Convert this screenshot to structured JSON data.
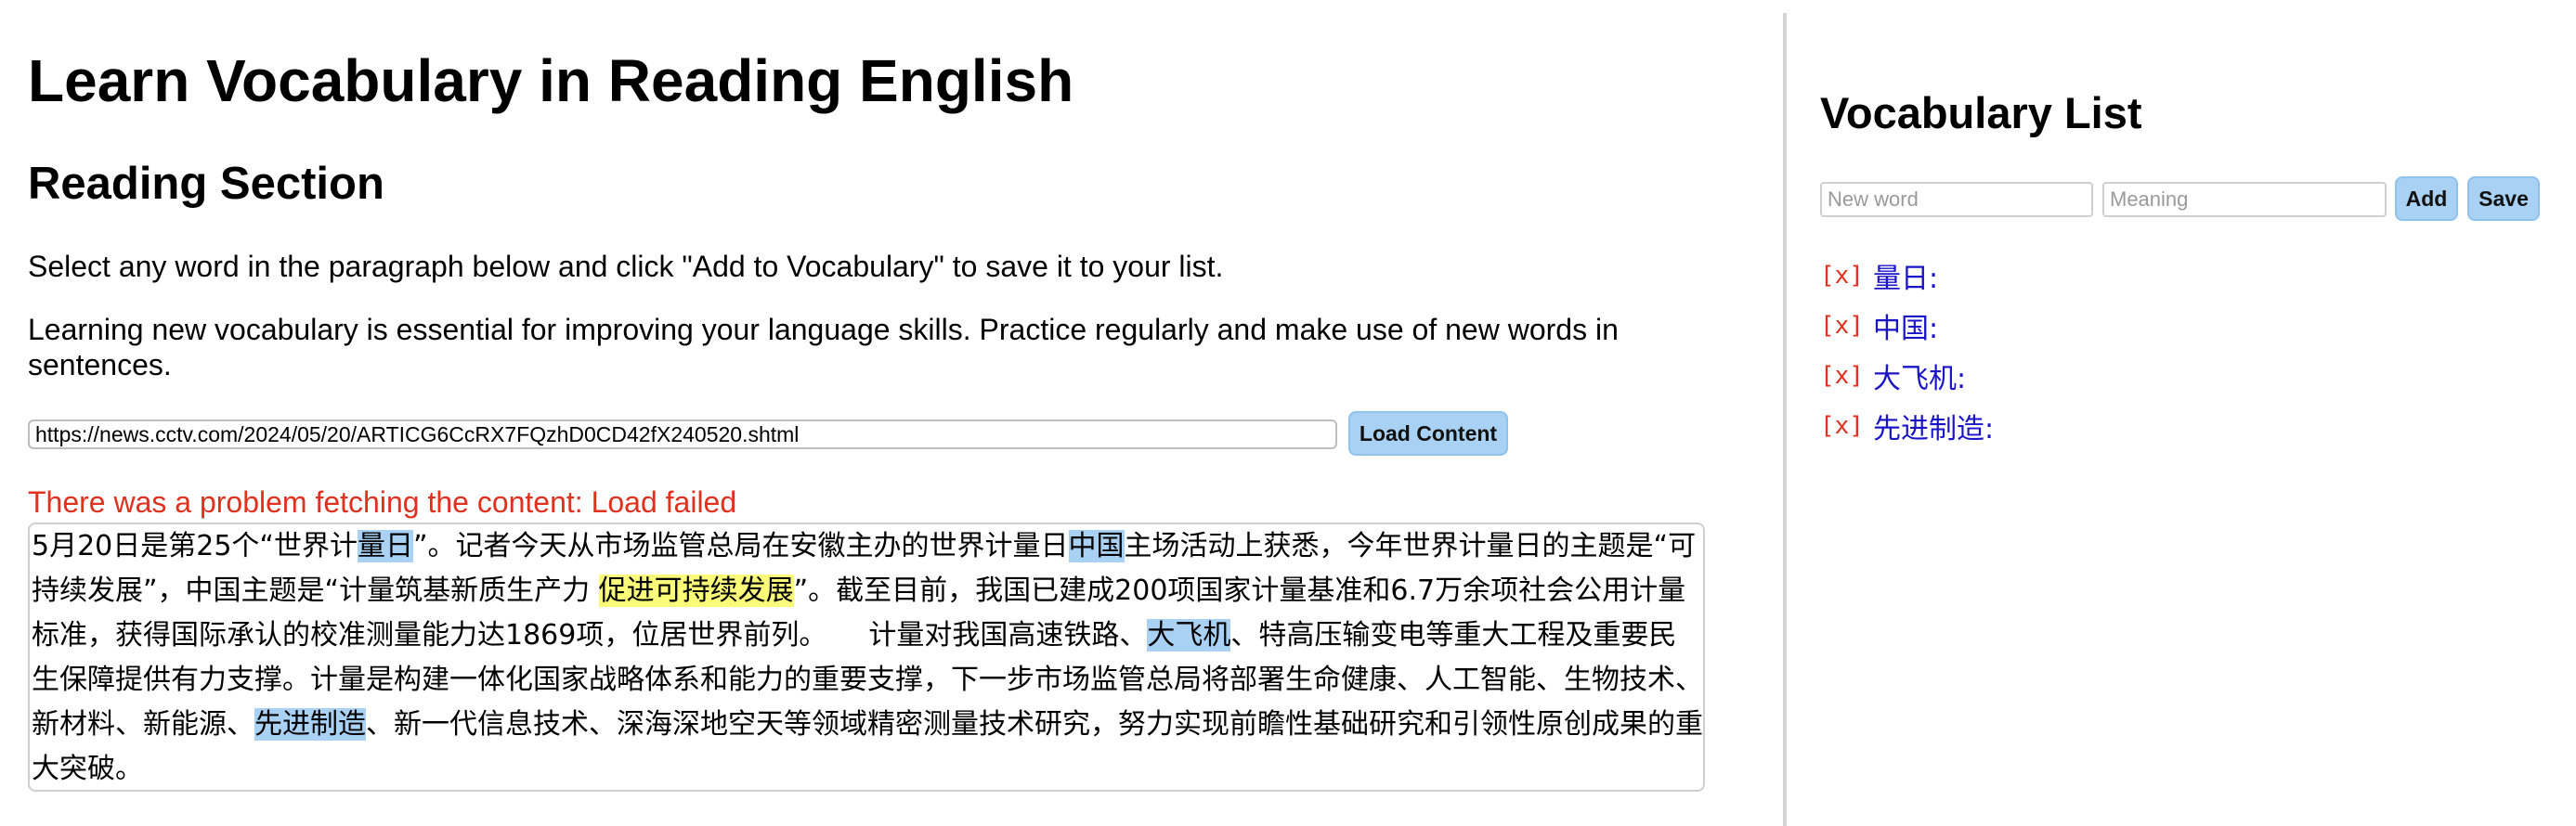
{
  "header": {
    "title": "Learn Vocabulary in Reading English"
  },
  "reading": {
    "title": "Reading Section",
    "instruction": "Select any word in the paragraph below and click \"Add to Vocabulary\" to save it to your list.",
    "tip": "Learning new vocabulary is essential for improving your language skills. Practice regularly and make use of new words in sentences.",
    "url_value": "https://news.cctv.com/2024/05/20/ARTICG6CcRX7FQzhD0CD42fX240520.shtml",
    "load_label": "Load Content",
    "error": "There was a problem fetching the content: Load failed",
    "content": [
      "5月20日是第25个“世界计",
      "量日",
      "”。记者今天从市场监管总局在安徽主办的世界计量日",
      "中国",
      "主场活动上获悉，今年世界计量日的主题是“可持续发展”，中国主题是“计量筑基新质生产力 ",
      "促进可持续发展",
      "”。截至目前，我国已建成200项国家计量基准和6.7万余项社会公用计量标准，获得国际承认的校准测量能力达1869项，位居世界前列。　　计量对我国高速铁路、",
      "大飞机",
      "、特高压输变电等重大工程及重要民生保障提供有力支撑。计量是构建一体化国家战略体系和能力的重要支撑，下一步市场监管总局将部署生命健康、人工智能、生物技术、新材料、新能源、",
      "先进制造",
      "、新一代信息技术、深海深地空天等领域精密测量技术研究，努力实现前瞻性基础研究和引领性原创成果的重大突破。"
    ]
  },
  "vocab": {
    "title": "Vocabulary List",
    "word_placeholder": "New word",
    "meaning_placeholder": "Meaning",
    "add_label": "Add",
    "save_label": "Save",
    "delete_label": "[x]",
    "items": [
      {
        "text": "量日:"
      },
      {
        "text": "中国:"
      },
      {
        "text": "大飞机:"
      },
      {
        "text": "先进制造:"
      }
    ]
  },
  "colors": {
    "accent_button": "#a8d1f3",
    "vocab_highlight": "#a8d1f3",
    "selection_highlight": "#fbfb7a",
    "error": "#e0301e",
    "vocab_link": "#1a14c8"
  }
}
